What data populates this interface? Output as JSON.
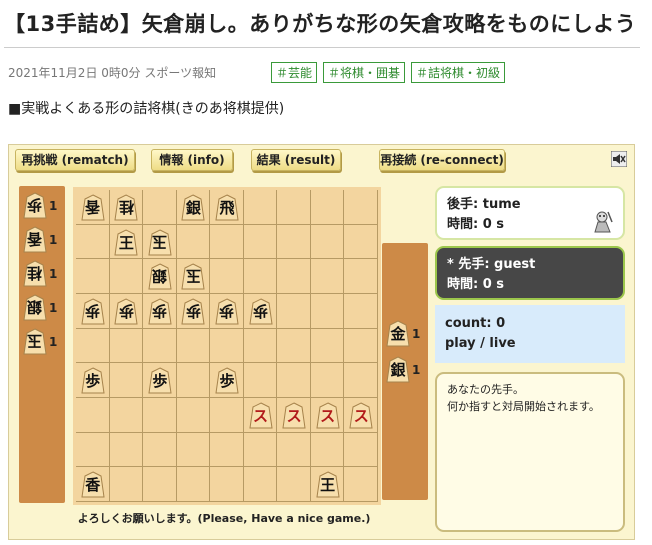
{
  "article": {
    "title": "【13手詰め】矢倉崩し。ありがちな形の矢倉攻略をものにしよう",
    "meta": "2021年11月2日 0時0分 スポーツ報知",
    "tags": [
      "＃芸能",
      "＃将棋・囲碁",
      "＃詰将棋・初級"
    ],
    "caption": "■実戦よくある形の詰将棋(きのあ将棋提供)"
  },
  "game": {
    "toolbar": {
      "rematch": "再挑戦 (rematch)",
      "info": "情報 (info)",
      "result": "結果 (result)",
      "reconnect": "再接続 (re-connect)"
    },
    "gote_hand": [
      {
        "piece": "歩",
        "count": "1"
      },
      {
        "piece": "香",
        "count": "1"
      },
      {
        "piece": "桂",
        "count": "1"
      },
      {
        "piece": "銀",
        "count": "1"
      },
      {
        "piece": "玉",
        "count": "1"
      }
    ],
    "sente_hand": [
      {
        "piece": "金",
        "count": "1"
      },
      {
        "piece": "銀",
        "count": "1"
      }
    ],
    "board": [
      {
        "r": 0,
        "c": 0,
        "p": "香",
        "side": "gote"
      },
      {
        "r": 0,
        "c": 1,
        "p": "桂",
        "side": "gote"
      },
      {
        "r": 0,
        "c": 3,
        "p": "銀",
        "side": "sente"
      },
      {
        "r": 0,
        "c": 4,
        "p": "飛",
        "side": "sente"
      },
      {
        "r": 1,
        "c": 1,
        "p": "王",
        "side": "sente"
      },
      {
        "r": 1,
        "c": 2,
        "p": "玉",
        "side": "gote"
      },
      {
        "r": 2,
        "c": 2,
        "p": "銀",
        "side": "gote"
      },
      {
        "r": 2,
        "c": 3,
        "p": "玉",
        "side": "gote"
      },
      {
        "r": 3,
        "c": 0,
        "p": "歩",
        "side": "gote"
      },
      {
        "r": 3,
        "c": 1,
        "p": "歩",
        "side": "gote"
      },
      {
        "r": 3,
        "c": 2,
        "p": "歩",
        "side": "gote"
      },
      {
        "r": 3,
        "c": 3,
        "p": "歩",
        "side": "gote"
      },
      {
        "r": 3,
        "c": 4,
        "p": "歩",
        "side": "gote"
      },
      {
        "r": 3,
        "c": 5,
        "p": "歩",
        "side": "gote"
      },
      {
        "r": 5,
        "c": 0,
        "p": "歩",
        "side": "sente"
      },
      {
        "r": 5,
        "c": 2,
        "p": "歩",
        "side": "sente"
      },
      {
        "r": 5,
        "c": 4,
        "p": "歩",
        "side": "sente"
      },
      {
        "r": 6,
        "c": 5,
        "p": "ス",
        "side": "red"
      },
      {
        "r": 6,
        "c": 6,
        "p": "ス",
        "side": "red"
      },
      {
        "r": 6,
        "c": 7,
        "p": "ス",
        "side": "red"
      },
      {
        "r": 6,
        "c": 8,
        "p": "ス",
        "side": "red"
      },
      {
        "r": 8,
        "c": 0,
        "p": "香",
        "side": "sente"
      },
      {
        "r": 8,
        "c": 7,
        "p": "王",
        "side": "sente"
      }
    ],
    "gote_player": {
      "name": "後手: tume",
      "time": "時間: 0 s"
    },
    "sente_player": {
      "name": "* 先手: guest",
      "time": "時間: 0 s"
    },
    "info": {
      "count": "count: 0",
      "mode": "play / live"
    },
    "message": {
      "line1": "あなたの先手。",
      "line2": "何か指すと対局開始されます。"
    },
    "status": "よろしくお願いします。(Please, Have a nice game.)"
  },
  "colors": {
    "board": "#f3d59f",
    "hand": "#cd8a47",
    "tag": "#2d8a2d",
    "sente_box": "#474747",
    "info_box": "#d8ebfb"
  },
  "icons": {
    "mute": "speaker-muted-icon",
    "avatar": "player-avatar-icon"
  }
}
